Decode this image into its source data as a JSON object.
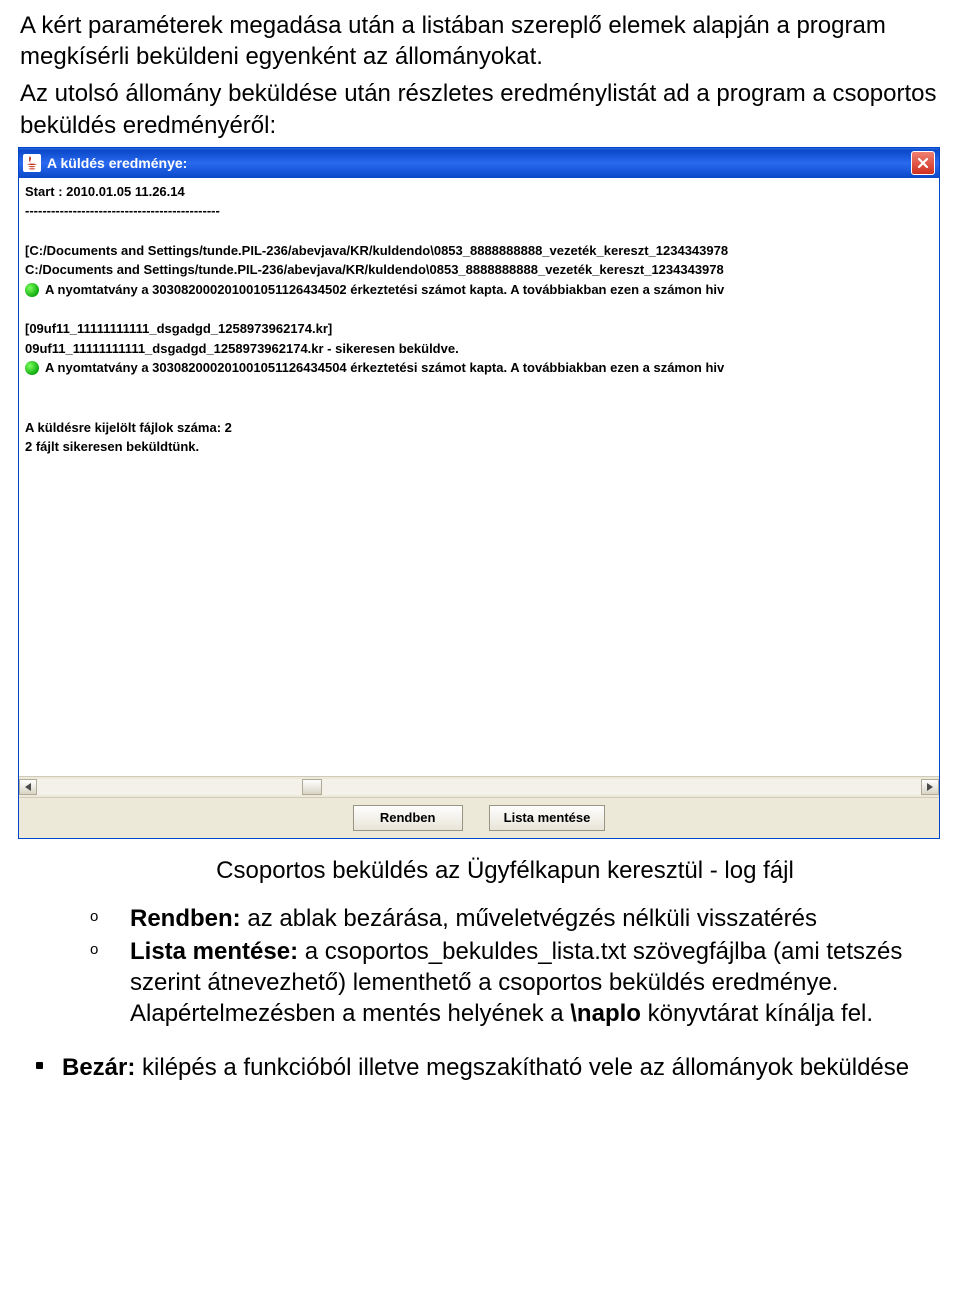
{
  "intro_p1": "A kért paraméterek megadása után a listában szereplő elemek alapján a program megkísérli beküldeni egyenként az állományokat.",
  "intro_p2": "Az utolsó állomány beküldése után részletes eredménylistát ad a program a csoportos beküldés eredményéről:",
  "window": {
    "title": "A küldés eredménye:",
    "log": {
      "l0": "Start : 2010.01.05 11.26.14",
      "l1": "---------------------------------------------",
      "l2": "[C:/Documents and Settings/tunde.PIL-236/abevjava/KR/kuldendo\\0853_8888888888_vezeték_kereszt_1234343978",
      "l3": "C:/Documents and Settings/tunde.PIL-236/abevjava/KR/kuldendo\\0853_8888888888_vezeték_kereszt_1234343978",
      "l4": "A nyomtatvány a 303082000201001051126434502 érkeztetési számot kapta. A továbbiakban ezen a számon hiv",
      "l5": "[09uf11_11111111111_dsgadgd_1258973962174.kr]",
      "l6": "09uf11_11111111111_dsgadgd_1258973962174.kr  - sikeresen beküldve.",
      "l7": "A nyomtatvány a 303082000201001051126434504 érkeztetési számot kapta. A továbbiakban ezen a számon hiv",
      "l8": "A küldésre kijelölt fájlok száma: 2",
      "l9": "2 fájlt sikeresen beküldtünk."
    },
    "buttons": {
      "ok": "Rendben",
      "save": "Lista mentése"
    }
  },
  "caption": "Csoportos beküldés az Ügyfélkapun keresztül - log fájl",
  "items": {
    "b0_label": "Rendben:",
    "b0_text": " az ablak bezárása, műveletvégzés nélküli visszatérés",
    "b1_label": "Lista mentése:",
    "b1_text_a": " a csoportos_bekuldes_lista.txt szövegfájlba (ami tetszés szerint átnevezhető) lementhető a csoportos beküldés eredménye. Alapértelmezésben a mentés helyének a ",
    "b1_bold": "\\naplo",
    "b1_text_b": " könyvtárat kínálja fel."
  },
  "final": {
    "label": "Bezár:",
    "text": " kilépés a funkcióból illetve megszakítható vele az állományok beküldése"
  },
  "bullet_o": "o"
}
